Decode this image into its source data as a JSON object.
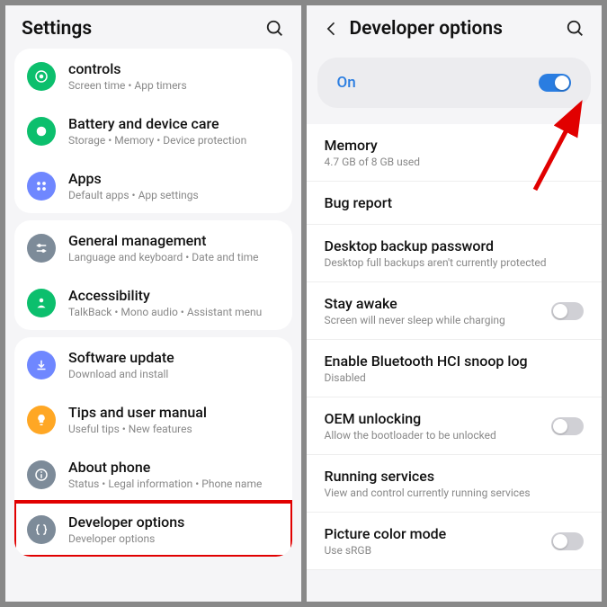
{
  "left": {
    "title": "Settings",
    "items": [
      {
        "label": "controls",
        "sub": "Screen time • App timers",
        "icon": "controls",
        "color": "#0cbf6d"
      },
      {
        "label": "Battery and device care",
        "sub": "Storage • Memory • Device protection",
        "icon": "battery",
        "color": "#0cbf6d"
      },
      {
        "label": "Apps",
        "sub": "Default apps • App settings",
        "icon": "apps",
        "color": "#6f87ff"
      }
    ],
    "items2": [
      {
        "label": "General management",
        "sub": "Language and keyboard • Date and time",
        "icon": "sliders",
        "color": "#7d8b99"
      },
      {
        "label": "Accessibility",
        "sub": "TalkBack • Mono audio • Assistant menu",
        "icon": "person",
        "color": "#0cbf6d"
      }
    ],
    "items3": [
      {
        "label": "Software update",
        "sub": "Download and install",
        "icon": "download",
        "color": "#6f87ff"
      },
      {
        "label": "Tips and user manual",
        "sub": "Useful tips • New features",
        "icon": "bulb",
        "color": "#ffa724"
      },
      {
        "label": "About phone",
        "sub": "Status • Legal information • Phone name",
        "icon": "info",
        "color": "#7d8b99"
      },
      {
        "label": "Developer options",
        "sub": "Developer options",
        "icon": "braces",
        "color": "#7d8b99"
      }
    ]
  },
  "right": {
    "title": "Developer options",
    "main_toggle": {
      "label": "On",
      "value": true
    },
    "rows": [
      {
        "label": "Memory",
        "sub": "4.7 GB of 8 GB used",
        "toggle": null
      },
      {
        "label": "Bug report",
        "sub": "",
        "toggle": null
      },
      {
        "label": "Desktop backup password",
        "sub": "Desktop full backups aren't currently protected",
        "toggle": null
      },
      {
        "label": "Stay awake",
        "sub": "Screen will never sleep while charging",
        "toggle": false
      },
      {
        "label": "Enable Bluetooth HCI snoop log",
        "sub": "Disabled",
        "toggle": null
      },
      {
        "label": "OEM unlocking",
        "sub": "Allow the bootloader to be unlocked",
        "toggle": false
      },
      {
        "label": "Running services",
        "sub": "View and control currently running services",
        "toggle": null
      },
      {
        "label": "Picture color mode",
        "sub": "Use sRGB",
        "toggle": false
      }
    ]
  },
  "annotations": {
    "highlight_index": 3,
    "arrow_target": "main_toggle"
  }
}
